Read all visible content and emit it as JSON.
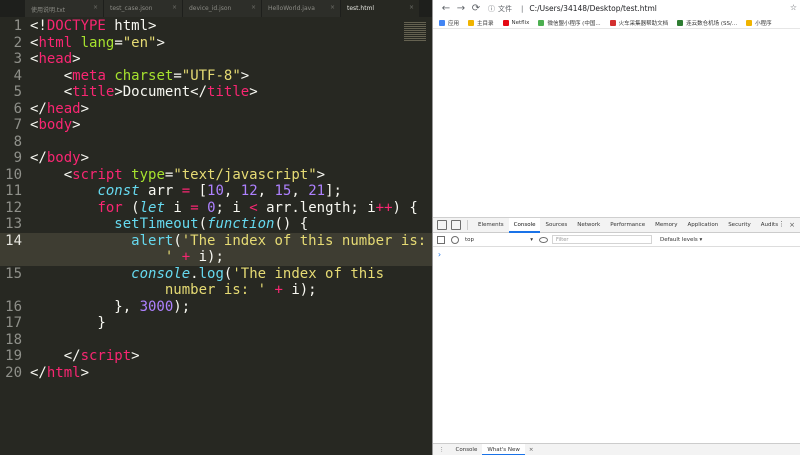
{
  "editor": {
    "tabs": [
      {
        "label": "使用说明.txt",
        "active": false
      },
      {
        "label": "test_case.json",
        "active": false
      },
      {
        "label": "device_id.json",
        "active": false
      },
      {
        "label": "HelloWorld.java",
        "active": false
      },
      {
        "label": "test.html",
        "active": true
      }
    ],
    "current_line": 14,
    "lines": [
      {
        "num": "1",
        "tokens": [
          {
            "t": "<!"
          },
          {
            "t": "DOCTYPE",
            "c": "tg"
          },
          {
            "t": " html>"
          }
        ]
      },
      {
        "num": "2",
        "tokens": [
          {
            "t": "<"
          },
          {
            "t": "html",
            "c": "tg"
          },
          {
            "t": " "
          },
          {
            "t": "lang",
            "c": "at"
          },
          {
            "t": "="
          },
          {
            "t": "\"en\"",
            "c": "s"
          },
          {
            "t": ">"
          }
        ]
      },
      {
        "num": "3",
        "tokens": [
          {
            "t": "<"
          },
          {
            "t": "head",
            "c": "tg"
          },
          {
            "t": ">"
          }
        ]
      },
      {
        "num": "4",
        "tokens": [
          {
            "t": "    <"
          },
          {
            "t": "meta",
            "c": "tg"
          },
          {
            "t": " "
          },
          {
            "t": "charset",
            "c": "at"
          },
          {
            "t": "="
          },
          {
            "t": "\"UTF-8\"",
            "c": "s"
          },
          {
            "t": ">"
          }
        ]
      },
      {
        "num": "5",
        "tokens": [
          {
            "t": "    <"
          },
          {
            "t": "title",
            "c": "tg"
          },
          {
            "t": ">Document</"
          },
          {
            "t": "title",
            "c": "tg"
          },
          {
            "t": ">"
          }
        ]
      },
      {
        "num": "6",
        "tokens": [
          {
            "t": "</"
          },
          {
            "t": "head",
            "c": "tg"
          },
          {
            "t": ">"
          }
        ]
      },
      {
        "num": "7",
        "tokens": [
          {
            "t": "<"
          },
          {
            "t": "body",
            "c": "tg"
          },
          {
            "t": ">"
          }
        ]
      },
      {
        "num": "8",
        "tokens": []
      },
      {
        "num": "9",
        "tokens": [
          {
            "t": "</"
          },
          {
            "t": "body",
            "c": "tg"
          },
          {
            "t": ">"
          }
        ]
      },
      {
        "num": "10",
        "tokens": [
          {
            "t": "    <"
          },
          {
            "t": "script",
            "c": "tg"
          },
          {
            "t": " "
          },
          {
            "t": "type",
            "c": "at"
          },
          {
            "t": "="
          },
          {
            "t": "\"text/javascript\"",
            "c": "s"
          },
          {
            "t": ">"
          }
        ]
      },
      {
        "num": "11",
        "tokens": [
          {
            "t": "        "
          },
          {
            "t": "const",
            "c": "it"
          },
          {
            "t": " arr "
          },
          {
            "t": "=",
            "c": "k"
          },
          {
            "t": " ["
          },
          {
            "t": "10",
            "c": "n"
          },
          {
            "t": ", "
          },
          {
            "t": "12",
            "c": "n"
          },
          {
            "t": ", "
          },
          {
            "t": "15",
            "c": "n"
          },
          {
            "t": ", "
          },
          {
            "t": "21",
            "c": "n"
          },
          {
            "t": "];"
          }
        ]
      },
      {
        "num": "12",
        "tokens": [
          {
            "t": "        "
          },
          {
            "t": "for",
            "c": "k"
          },
          {
            "t": " ("
          },
          {
            "t": "let",
            "c": "it"
          },
          {
            "t": " i "
          },
          {
            "t": "=",
            "c": "k"
          },
          {
            "t": " "
          },
          {
            "t": "0",
            "c": "n"
          },
          {
            "t": "; i "
          },
          {
            "t": "<",
            "c": "k"
          },
          {
            "t": " arr.length; i"
          },
          {
            "t": "++",
            "c": "k"
          },
          {
            "t": ") {"
          }
        ]
      },
      {
        "num": "13",
        "tokens": [
          {
            "t": "          "
          },
          {
            "t": "setTimeout",
            "c": "f"
          },
          {
            "t": "("
          },
          {
            "t": "function",
            "c": "it"
          },
          {
            "t": "() {"
          }
        ]
      },
      {
        "num": "14",
        "tokens": [
          {
            "t": "            "
          },
          {
            "t": "alert",
            "c": "f"
          },
          {
            "t": "("
          },
          {
            "t": "'The index of this number is:",
            "c": "s"
          }
        ]
      },
      {
        "num": "",
        "tokens": [
          {
            "t": "                "
          },
          {
            "t": "' ",
            "c": "s"
          },
          {
            "t": "+",
            "c": "k"
          },
          {
            "t": " i);"
          }
        ]
      },
      {
        "num": "15",
        "tokens": [
          {
            "t": "            "
          },
          {
            "t": "console",
            "c": "it"
          },
          {
            "t": "."
          },
          {
            "t": "log",
            "c": "f"
          },
          {
            "t": "("
          },
          {
            "t": "'The index of this",
            "c": "s"
          }
        ]
      },
      {
        "num": "",
        "tokens": [
          {
            "t": "                "
          },
          {
            "t": "number is: '",
            "c": "s"
          },
          {
            "t": " "
          },
          {
            "t": "+",
            "c": "k"
          },
          {
            "t": " i);"
          }
        ]
      },
      {
        "num": "16",
        "tokens": [
          {
            "t": "          }, "
          },
          {
            "t": "3000",
            "c": "n"
          },
          {
            "t": ");"
          }
        ]
      },
      {
        "num": "17",
        "tokens": [
          {
            "t": "        }"
          }
        ]
      },
      {
        "num": "18",
        "tokens": []
      },
      {
        "num": "19",
        "tokens": [
          {
            "t": "    </"
          },
          {
            "t": "script",
            "c": "tg"
          },
          {
            "t": ">"
          }
        ]
      },
      {
        "num": "20",
        "tokens": [
          {
            "t": "</"
          },
          {
            "t": "html",
            "c": "tg"
          },
          {
            "t": ">"
          }
        ]
      }
    ]
  },
  "browser": {
    "nav": {
      "back": "←",
      "forward": "→",
      "reload": "⟳"
    },
    "address": {
      "icon": "ⓘ",
      "label": "文件",
      "separator": "|",
      "url": "C:/Users/34148/Desktop/test.html"
    },
    "star": "☆",
    "bookmarks": [
      {
        "label": "应用",
        "color": "#4285f4"
      },
      {
        "label": "主目录",
        "color": "#f0b400"
      },
      {
        "label": "Netflix",
        "color": "#e50914"
      },
      {
        "label": "微信盟小程序 (中国...",
        "color": "#4caf50"
      },
      {
        "label": "火车采集器帮助文档",
        "color": "#d32f2f"
      },
      {
        "label": "连云数仓机场 (SS/...",
        "color": "#2e7d32"
      },
      {
        "label": "小程序",
        "color": "#f0b400"
      }
    ],
    "devtools": {
      "tabs": [
        "Elements",
        "Console",
        "Sources",
        "Network",
        "Performance",
        "Memory",
        "Application",
        "Security",
        "Audits"
      ],
      "active_tab": "Console",
      "menu": "⋮",
      "close": "×",
      "console": {
        "context": "top",
        "context_caret": "▾",
        "filter_placeholder": "Filter",
        "levels": "Default levels ▾",
        "prompt": "›"
      },
      "drawer": {
        "menu": "⋮",
        "tabs": [
          "Console",
          "What's New"
        ],
        "active_tab": "What's New",
        "close": "×"
      }
    }
  }
}
